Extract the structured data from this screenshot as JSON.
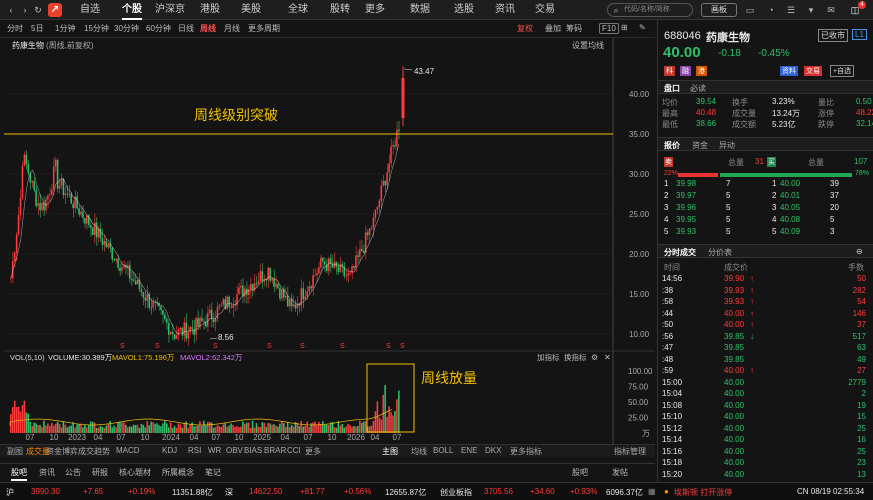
{
  "topbar": {
    "logo": "↗",
    "nav": [
      "自选",
      "个股",
      "沪深京",
      "港股",
      "美股",
      "全球",
      "股转",
      "更多",
      "数据",
      "选股",
      "资讯",
      "交易"
    ],
    "active_nav": 1,
    "search_placeholder": "代码/名称/简称",
    "panel_button": "画板"
  },
  "periodbar": {
    "items": [
      "分时",
      "5日",
      "1分钟",
      "15分钟",
      "30分钟",
      "60分钟",
      "日线",
      "周线",
      "月线",
      "更多周期"
    ],
    "active": 7,
    "right_items": [
      "复权",
      "叠加",
      "筹码"
    ],
    "f10": "F10"
  },
  "chart": {
    "stock_label": "药康生物",
    "stock_label_sub": "(周线,前复权)",
    "settings": "设置均线",
    "annotation_breakout": "周线级别突破",
    "annotation_volume": "周线放量",
    "high_label": "43.47",
    "low_label": "8.56",
    "price_ticks": [
      "40.00",
      "35.00",
      "30.00",
      "25.00",
      "20.00",
      "15.00",
      "10.00"
    ],
    "vol_ticks": [
      "100.00",
      "75.00",
      "50.00",
      "25.00",
      "万"
    ],
    "x_labels": [
      "07",
      "10",
      "2023",
      "04",
      "07",
      "10",
      "2024",
      "04",
      "07",
      "10",
      "2025",
      "04",
      "07",
      "10",
      "2026",
      "04",
      "07"
    ],
    "signal_marks": [
      "S",
      "S",
      "S",
      "S",
      "S",
      "S",
      "S",
      "S",
      "S",
      "S"
    ],
    "vol_label": "VOL(5,10)",
    "vol_value": "VOLUME:30.389万",
    "mavol1": "MAVOL1:75.196万",
    "mavol2": "MAVOL2:62.342万",
    "vol_right": [
      "加指标",
      "换指标"
    ],
    "breakout_level": 35.0,
    "colors": {
      "up": "#ff3b3b",
      "down": "#2fc06a",
      "ma": "#f0c000",
      "annot": "#f0c000"
    }
  },
  "indicator_tabs": {
    "left": [
      "副图",
      "成交量",
      "资金博弈",
      "成交趋势",
      "MACD",
      "KDJ",
      "RSI",
      "WR",
      "OBV",
      "BIAS",
      "BRAR",
      "CCI",
      "更多"
    ],
    "right": [
      "主图",
      "均线",
      "BOLL",
      "ENE",
      "DKX",
      "更多指标"
    ],
    "manage": "指标管理",
    "active": 1
  },
  "bottom_tabs": {
    "items": [
      "股吧",
      "资讯",
      "公告",
      "研报",
      "核心题材",
      "所属概念",
      "笔记"
    ],
    "active": 0,
    "right": [
      "股吧",
      "发帖"
    ]
  },
  "status": {
    "sh_label": "沪",
    "sh_val": "3990.30",
    "sh_chg": "+7.65",
    "sh_pct": "+0.19%",
    "sh_amt": "11351.88亿",
    "sz_label": "深",
    "sz_val": "14622.50",
    "sz_chg": "+81.77",
    "sz_pct": "+0.56%",
    "sz_amt": "12655.87亿",
    "cy_label": "创业板指",
    "cy_val": "3705.56",
    "cy_chg": "+34.60",
    "cy_pct": "+0.93%",
    "cy_amt": "6096.37亿",
    "news": "埃斯顿 打开涨停",
    "time": "CN 08/19 02:55:34"
  },
  "quote": {
    "code": "688046",
    "name": "药康生物",
    "tag": "已收市",
    "level": "L1",
    "price": "40.00",
    "chg": "-0.18",
    "pct": "-0.45%",
    "badges": [
      "科",
      "融",
      "港"
    ],
    "right_badges": [
      "资料",
      "交易",
      "+自选"
    ],
    "tabs": [
      "盘口",
      "必读"
    ],
    "stats": [
      [
        "均价",
        "39.54",
        "换手",
        "3.23%",
        "量比",
        "0.50"
      ],
      [
        "最高",
        "40.48",
        "成交量",
        "13.24万",
        "涨停",
        "48.22"
      ],
      [
        "最低",
        "38.66",
        "成交额",
        "5.23亿",
        "跌停",
        "32.14"
      ]
    ]
  },
  "orderbook": {
    "tabs": [
      "报价",
      "资金",
      "异动"
    ],
    "sell_label": "卖",
    "total_label": "总量",
    "total_sell": "31",
    "buy_label": "买",
    "total_buy": "107",
    "sell_pct": "22%",
    "buy_pct": "78%",
    "rows": [
      [
        "1",
        "39.98",
        "7",
        "1",
        "40.00",
        "39"
      ],
      [
        "2",
        "39.97",
        "5",
        "2",
        "40.01",
        "37"
      ],
      [
        "3",
        "39.96",
        "5",
        "3",
        "40.05",
        "20"
      ],
      [
        "4",
        "39.95",
        "5",
        "4",
        "40.08",
        "5"
      ],
      [
        "5",
        "39.93",
        "5",
        "5",
        "40.09",
        "3"
      ]
    ]
  },
  "ticks": {
    "tabs": [
      "分时成交",
      "分价表"
    ],
    "headers": [
      "时间",
      "成交价",
      "手数"
    ],
    "rows": [
      [
        "14:56",
        "39.90",
        "↑",
        "50",
        "r"
      ],
      [
        ":38",
        "39.93",
        "↑",
        "282",
        "r"
      ],
      [
        ":58",
        "39.93",
        "↑",
        "54",
        "r"
      ],
      [
        ":44",
        "40.00",
        "↑",
        "146",
        "r"
      ],
      [
        ":50",
        "40.00",
        "↑",
        "37",
        "r"
      ],
      [
        ":56",
        "39.85",
        "↓",
        "517",
        "g"
      ],
      [
        ":47",
        "39.85",
        "",
        "63",
        "g"
      ],
      [
        ":48",
        "39.85",
        "",
        "49",
        "g"
      ],
      [
        ":59",
        "40.00",
        "↑",
        "27",
        "r"
      ],
      [
        "15:00",
        "40.00",
        "",
        "2779",
        "g"
      ],
      [
        "15:04",
        "40.00",
        "",
        "2",
        "g"
      ],
      [
        "15:08",
        "40.00",
        "",
        "19",
        "g"
      ],
      [
        "15:10",
        "40.00",
        "",
        "15",
        "g"
      ],
      [
        "15:12",
        "40.00",
        "",
        "25",
        "g"
      ],
      [
        "15:14",
        "40.00",
        "",
        "16",
        "g"
      ],
      [
        "15:16",
        "40.00",
        "",
        "25",
        "g"
      ],
      [
        "15:18",
        "40.00",
        "",
        "23",
        "g"
      ],
      [
        "15:20",
        "40.00",
        "",
        "13",
        "g"
      ]
    ]
  }
}
